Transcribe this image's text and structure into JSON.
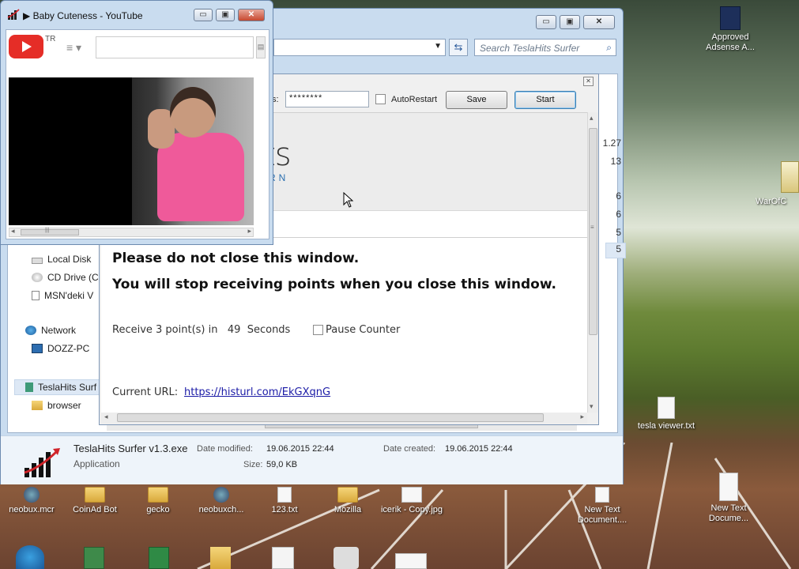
{
  "youtube_window": {
    "title": "Baby Cuteness - YouTube",
    "play_glyph": "▶",
    "region": "TR",
    "menu_glyph": "≡ ▾",
    "scroll_glyph": "▤",
    "thumb_glyph": "|||",
    "left_arrow": "◂",
    "right_arrow": "▸",
    "min_glyph": "▭",
    "max_glyph": "▣",
    "close_glyph": "✕"
  },
  "explorer": {
    "search_placeholder": "Search TeslaHits Surfer",
    "dropdown_glyph": "▼",
    "refresh_glyph": "⇆",
    "search_glyph": "⌕",
    "min_glyph": "▭",
    "max_glyph": "▣",
    "close_glyph": "✕",
    "nav_items": [
      {
        "label": "Local Disk"
      },
      {
        "label": "CD Drive (C"
      },
      {
        "label": "MSN'deki V"
      },
      {
        "label": "Network"
      },
      {
        "label": "DOZZ-PC"
      },
      {
        "label": "TeslaHits Surf"
      },
      {
        "label": "browser"
      }
    ],
    "right_values": [
      "1.27",
      "13",
      "6",
      "6",
      "5",
      "5"
    ],
    "details": {
      "file_name": "TeslaHits Surfer v1.3.exe",
      "file_type": "Application",
      "modified_label": "Date modified:",
      "modified_value": "19.06.2015 22:44",
      "created_label": "Date created:",
      "created_value": "19.06.2015 22:44",
      "size_label": "Size:",
      "size_value": "59,0 KB"
    }
  },
  "surfer": {
    "close_glyph": "✕",
    "password_label": "s:",
    "password_value": "********",
    "autorestart_label": "AutoRestart",
    "save_label": "Save",
    "start_label": "Start",
    "logo_text": "its",
    "logo_sub": "ARN",
    "message_line1": "Please do not close this window.",
    "message_line2": "You will stop receiving points when you close this window.",
    "counter_prefix": "Receive 3 point(s) in",
    "counter_seconds": "49",
    "counter_suffix": "Seconds",
    "pause_label": "Pause Counter",
    "current_url_label": "Current URL:",
    "current_url": "https://histurl.com/EkGXqnG",
    "up_arrow": "▴",
    "down_arrow": "▾",
    "left_arrow": "◂",
    "right_arrow": "▸",
    "grip_glyph": "≡"
  },
  "desktop_icons": [
    {
      "label": "Approved Adsense A..."
    },
    {
      "label": "WarOfC"
    },
    {
      "label": "tesla viewer.txt"
    },
    {
      "label": "neobux.mcr"
    },
    {
      "label": "CoinAd Bot"
    },
    {
      "label": "gecko"
    },
    {
      "label": "neobuxch..."
    },
    {
      "label": "123.txt"
    },
    {
      "label": "Mozilla"
    },
    {
      "label": "icerik - Copy.jpg"
    },
    {
      "label": "New Text Document...."
    },
    {
      "label": "New Text Docume..."
    }
  ]
}
